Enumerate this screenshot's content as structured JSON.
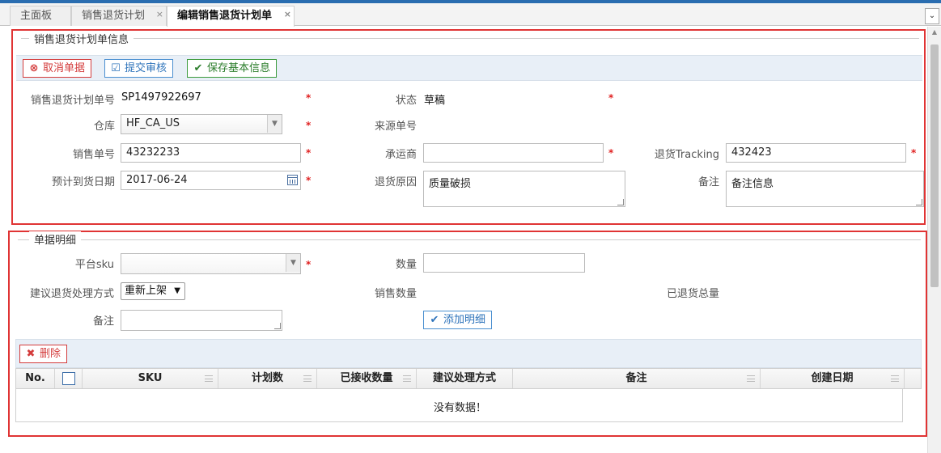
{
  "tabs": [
    {
      "label": "主面板"
    },
    {
      "label": "销售退货计划",
      "close": "×"
    },
    {
      "label": "编辑销售退货计划单",
      "close": "×"
    }
  ],
  "tab_scroll": "⌄",
  "basic": {
    "legend": "销售退货计划单信息",
    "buttons": {
      "cancel": "取消单据",
      "submit": "提交审核",
      "save": "保存基本信息"
    },
    "plan_no_label": "销售退货计划单号",
    "plan_no": "SP1497922697",
    "status_label": "状态",
    "status": "草稿",
    "warehouse_label": "仓库",
    "warehouse": "HF_CA_US",
    "source_no_label": "来源单号",
    "sales_no_label": "销售单号",
    "sales_no": "43232233",
    "carrier_label": "承运商",
    "carrier": "",
    "tracking_label": "退货Tracking",
    "tracking": "432423",
    "eta_label": "预计到货日期",
    "eta": "2017-06-24",
    "reason_label": "退货原因",
    "reason": "质量破损",
    "remark_label": "备注",
    "remark": "备注信息"
  },
  "detail": {
    "legend": "单据明细",
    "sku_label": "平台sku",
    "sku": "",
    "qty_label": "数量",
    "qty": "",
    "method_label": "建议退货处理方式",
    "method": "重新上架",
    "sold_qty_label": "销售数量",
    "returned_total_label": "已退货总量",
    "remark_label": "备注",
    "remark": "",
    "add_button": "添加明细",
    "delete_button": "删除"
  },
  "grid": {
    "columns": [
      "No.",
      "",
      "SKU",
      "计划数",
      "已接收数量",
      "建议处理方式",
      "备注",
      "创建日期"
    ],
    "empty_message": "没有数据！"
  },
  "required_mark": "*",
  "colors": {
    "accent": "#2a6db0",
    "required": "#e02020",
    "highlight_border": "#e03434"
  }
}
